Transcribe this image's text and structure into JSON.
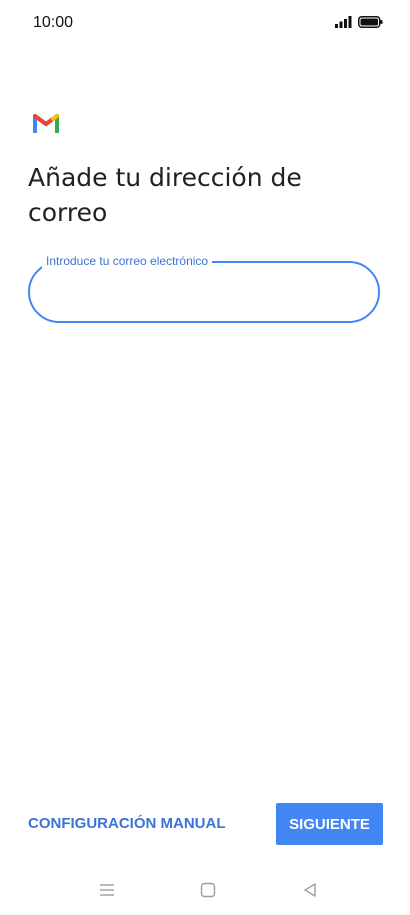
{
  "status_bar": {
    "time": "10:00",
    "icons": [
      "signal-icon",
      "battery-icon"
    ]
  },
  "brand": {
    "logo": "gmail-logo-icon",
    "colors": {
      "blue": "#4285f4",
      "red": "#ea4335",
      "yellow": "#fbbc04",
      "green": "#34a853"
    }
  },
  "page": {
    "title": "Añade tu dirección de correo"
  },
  "email_field": {
    "label": "Introduce tu correo electrónico",
    "value": ""
  },
  "actions": {
    "manual_label": "CONFIGURACIÓN MANUAL",
    "next_label": "SIGUIENTE"
  },
  "nav_bar": {
    "icons": [
      "menu-icon",
      "home-icon",
      "back-icon"
    ]
  },
  "theme": {
    "accent": "#4285f4",
    "accent_text": "#3b73d6"
  }
}
